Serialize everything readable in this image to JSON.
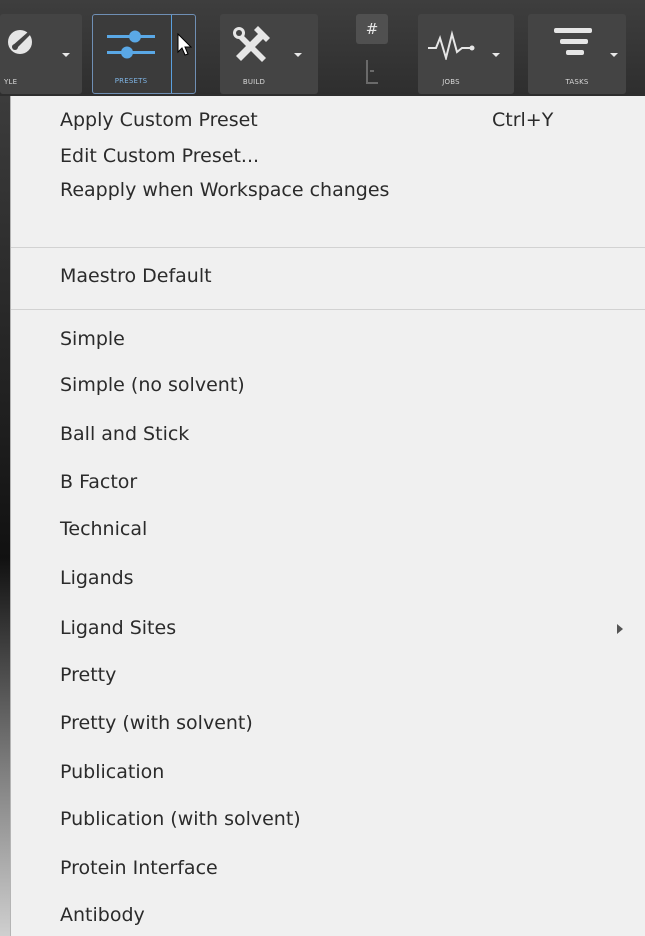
{
  "toolbar": {
    "buttons": [
      {
        "label": "YLE",
        "icon": "style-icon"
      },
      {
        "label": "PRESETS",
        "icon": "sliders-icon"
      },
      {
        "label": "BUILD",
        "icon": "build-tools-icon"
      },
      {
        "label": "#",
        "icon": "grid-icon"
      },
      {
        "label": "JOBS",
        "icon": "pulse-icon"
      },
      {
        "label": "TASKS",
        "icon": "tasks-icon"
      }
    ]
  },
  "menu": {
    "header_items": [
      {
        "label": "Apply Custom Preset",
        "shortcut": "Ctrl+Y"
      },
      {
        "label": "Edit Custom Preset..."
      },
      {
        "label": "Reapply when Workspace changes"
      }
    ],
    "default_item": {
      "label": "Maestro Default"
    },
    "presets": [
      {
        "label": "Simple"
      },
      {
        "label": "Simple (no solvent)"
      },
      {
        "label": "Ball and Stick"
      },
      {
        "label": "B Factor"
      },
      {
        "label": "Technical"
      },
      {
        "label": "Ligands"
      },
      {
        "label": "Ligand Sites",
        "has_submenu": true
      },
      {
        "label": "Pretty"
      },
      {
        "label": "Pretty (with solvent)"
      },
      {
        "label": "Publication"
      },
      {
        "label": "Publication (with solvent)"
      },
      {
        "label": "Protein Interface"
      },
      {
        "label": "Antibody"
      }
    ]
  }
}
